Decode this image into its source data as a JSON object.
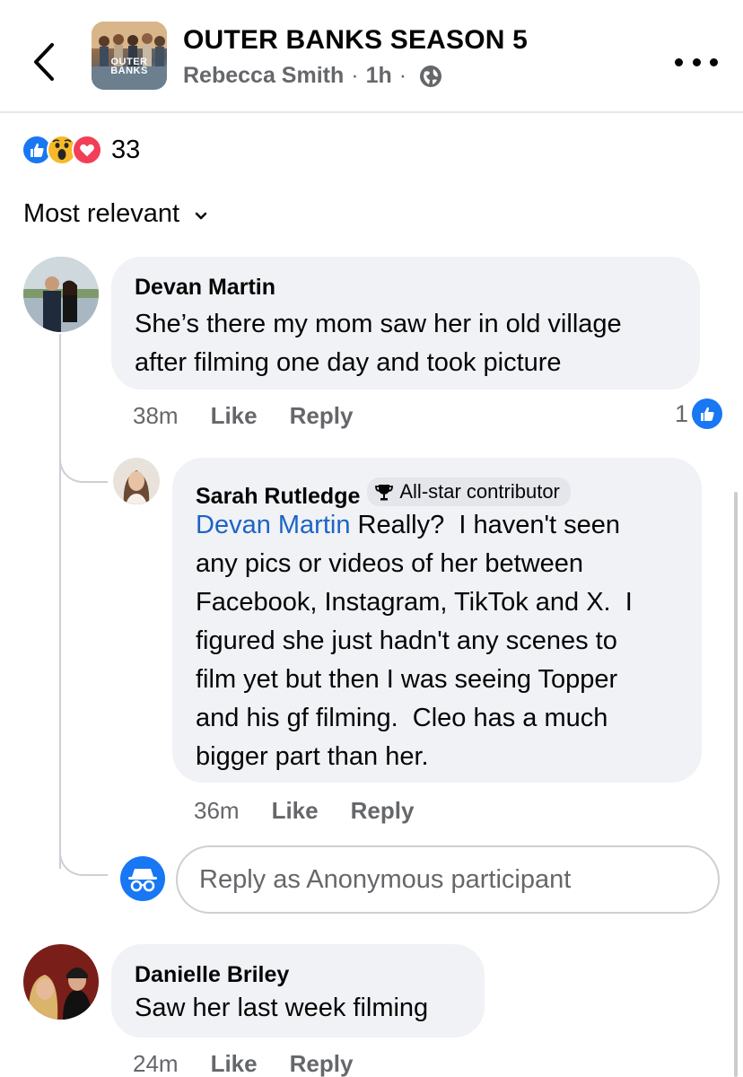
{
  "header": {
    "title": "OUTER BANKS SEASON 5",
    "author": "Rebecca Smith",
    "time": "1h",
    "separator": "·",
    "thumb_text": "OUTER BANKS"
  },
  "reactions": {
    "count": "33",
    "icons": [
      "like-icon",
      "wow-icon",
      "love-icon"
    ]
  },
  "sort": {
    "label": "Most relevant"
  },
  "comments": [
    {
      "name": "Devan Martin",
      "lines": [
        "She’s there my mom saw her in old village",
        "after filming one day and took picture"
      ],
      "time": "38m",
      "like_label": "Like",
      "reply_label": "Reply",
      "like_count": "1"
    },
    {
      "name": "Sarah Rutledge",
      "badge": "All-star contributor",
      "mention": "Devan Martin",
      "first_line_rest": " Really?  I haven't seen",
      "lines": [
        "any pics or videos of her between",
        "Facebook, Instagram, TikTok and X.  I",
        "figured she just hadn't any scenes to",
        "film yet but then I was seeing Topper",
        "and his gf filming.  Cleo has a much",
        "bigger part than her."
      ],
      "time": "36m",
      "like_label": "Like",
      "reply_label": "Reply"
    },
    {
      "name": "Danielle Briley",
      "lines": [
        "Saw her last week filming"
      ],
      "time": "24m",
      "like_label": "Like",
      "reply_label": "Reply"
    }
  ],
  "reply_box": {
    "placeholder": "Reply as Anonymous participant"
  },
  "colors": {
    "accent": "#1877f2",
    "mention": "#1d63c7",
    "bubble": "#f0f2f5",
    "secondary_text": "#65676b"
  }
}
